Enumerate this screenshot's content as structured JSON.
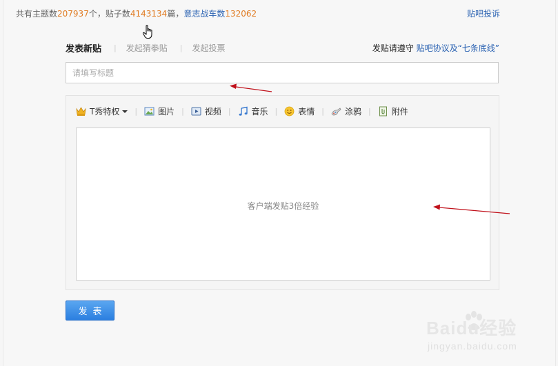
{
  "stats": {
    "topics_label": "共有主题数",
    "topics_value": "207937",
    "topics_unit": "个",
    "sep1": "，",
    "posts_label": "贴子数",
    "posts_value": "4143134",
    "posts_unit": "篇",
    "sep2": "，",
    "team_label": "意志战车数",
    "team_value": "132062"
  },
  "report_link": "贴吧投诉",
  "tabs": {
    "active": "发表新贴",
    "items": [
      "发起猜拳贴",
      "发起投票"
    ]
  },
  "rules": {
    "prefix": "发贴请遵守",
    "link": "贴吧协议及“七条底线”"
  },
  "title_input": {
    "placeholder": "请填写标题",
    "value": ""
  },
  "toolbar": {
    "items": [
      {
        "label": "T秀特权",
        "icon": "crown-icon"
      },
      {
        "label": "图片",
        "icon": "image-icon"
      },
      {
        "label": "视频",
        "icon": "video-icon"
      },
      {
        "label": "音乐",
        "icon": "music-icon"
      },
      {
        "label": "表情",
        "icon": "smiley-icon"
      },
      {
        "label": "涂鸦",
        "icon": "graffiti-icon"
      },
      {
        "label": "附件",
        "icon": "attachment-icon"
      }
    ]
  },
  "content_hint": "客户端发贴3倍经验",
  "submit_label": "发表",
  "watermark": {
    "line1": "Baidu经验",
    "line2": "jingyan.baidu.com"
  },
  "colors": {
    "link": "#2d64b3",
    "number": "#e07b22",
    "button": "#2b7fe0",
    "annotation_arrow": "#c0101a"
  }
}
